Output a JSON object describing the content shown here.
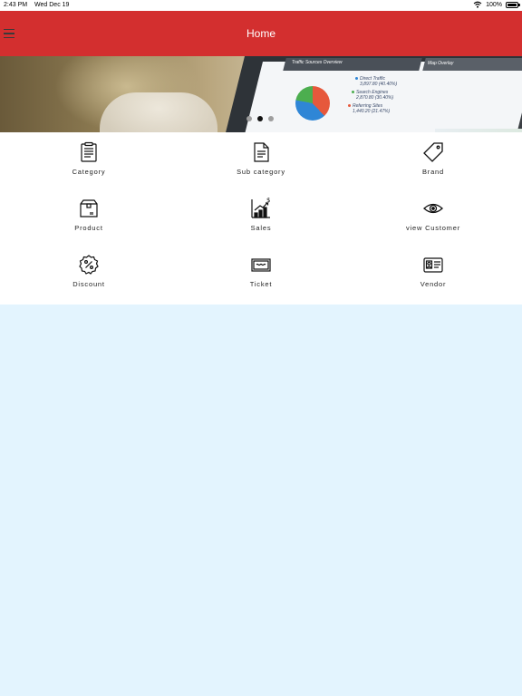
{
  "status_bar": {
    "time": "2:43 PM",
    "date": "Wed Dec 19",
    "battery": "100%"
  },
  "app_bar": {
    "title": "Home"
  },
  "banner": {
    "panel_title": "Traffic Sources Overview",
    "panel_title_2": "Map Overlay",
    "legend": [
      {
        "label": "Direct Traffic",
        "sub": "3,897.80 (40.40%)",
        "color": "#2f86d6"
      },
      {
        "label": "Search Engines",
        "sub": "2,870.80 (30.40%)",
        "color": "#4cae4f"
      },
      {
        "label": "Referring Sites",
        "sub": "1,440.20 (21.47%)",
        "color": "#e6583c"
      }
    ],
    "slides": 3,
    "active_slide": 1
  },
  "menu": [
    {
      "label": "Category",
      "icon": "clipboard-icon"
    },
    {
      "label": "Sub category",
      "icon": "document-icon"
    },
    {
      "label": "Brand",
      "icon": "tag-icon"
    },
    {
      "label": "Product",
      "icon": "box-icon"
    },
    {
      "label": "Sales",
      "icon": "sales-chart-icon"
    },
    {
      "label": "view Customer",
      "icon": "eye-icon"
    },
    {
      "label": "Discount",
      "icon": "discount-badge-icon"
    },
    {
      "label": "Ticket",
      "icon": "ticket-icon"
    },
    {
      "label": "Vendor",
      "icon": "id-card-icon"
    }
  ]
}
